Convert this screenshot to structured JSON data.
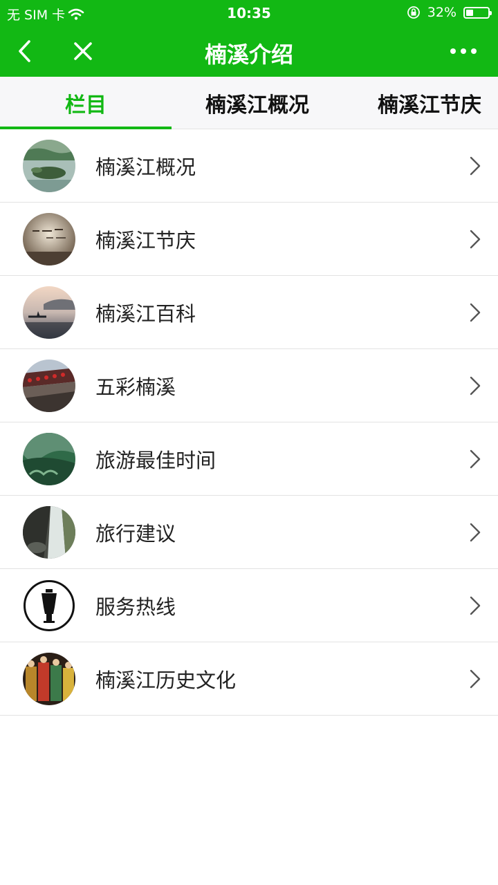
{
  "status_bar": {
    "carrier": "无 SIM 卡",
    "time": "10:35",
    "battery": "32%",
    "battery_level": 0.32,
    "wifi_icon": "wifi-icon",
    "lock_icon": "rotation-lock-icon"
  },
  "nav": {
    "title": "楠溪介绍",
    "back_icon": "chevron-left-icon",
    "close_icon": "close-icon",
    "more_icon": "more-dots-icon"
  },
  "tabs": [
    {
      "label": "栏目",
      "active": true
    },
    {
      "label": "楠溪江概况",
      "active": false
    },
    {
      "label": "楠溪江节庆",
      "active": false
    }
  ],
  "list": [
    {
      "label": "楠溪江概况",
      "thumb": "river-island-photo"
    },
    {
      "label": "楠溪江节庆",
      "thumb": "calligraphy-photo"
    },
    {
      "label": "楠溪江百科",
      "thumb": "fisherman-mist-photo"
    },
    {
      "label": "五彩楠溪",
      "thumb": "lantern-corridor-photo"
    },
    {
      "label": "旅游最佳时间",
      "thumb": "green-valley-photo"
    },
    {
      "label": "旅行建议",
      "thumb": "waterfall-photo"
    },
    {
      "label": "服务热线",
      "thumb": "figure-logo-icon"
    },
    {
      "label": "楠溪江历史文化",
      "thumb": "opera-costume-photo"
    }
  ],
  "colors": {
    "brand_green": "#12b814",
    "tab_bg": "#f7f7f9",
    "divider": "#e2e2e2"
  }
}
